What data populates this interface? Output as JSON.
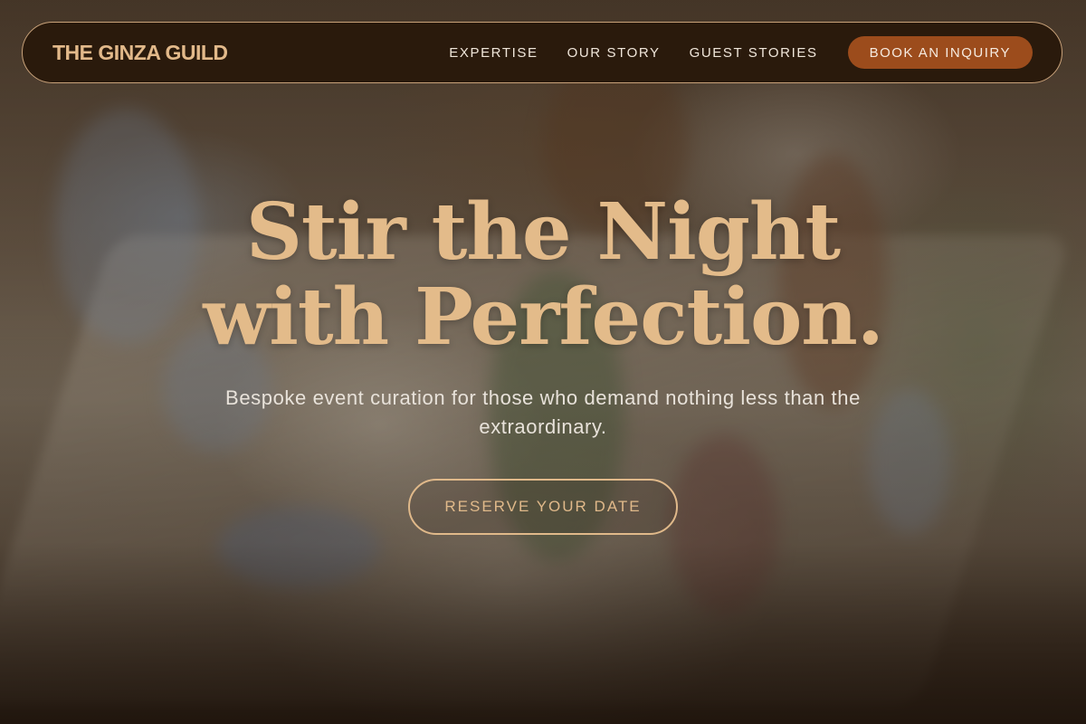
{
  "nav": {
    "brand": "THE GINZA GUILD",
    "links": [
      {
        "label": "EXPERTISE"
      },
      {
        "label": "OUR STORY"
      },
      {
        "label": "GUEST STORIES"
      }
    ],
    "cta_label": "BOOK AN INQUIRY"
  },
  "hero": {
    "title_line1": "Stir the Night",
    "title_line2": "with Perfection.",
    "subtitle": "Bespoke event curation for those who demand nothing less than the extraordinary.",
    "button_label": "RESERVE YOUR DATE"
  },
  "colors": {
    "accent_gold": "#e3bb8a",
    "nav_background": "#2a1a0c",
    "cta_background": "#9c4c1c"
  }
}
